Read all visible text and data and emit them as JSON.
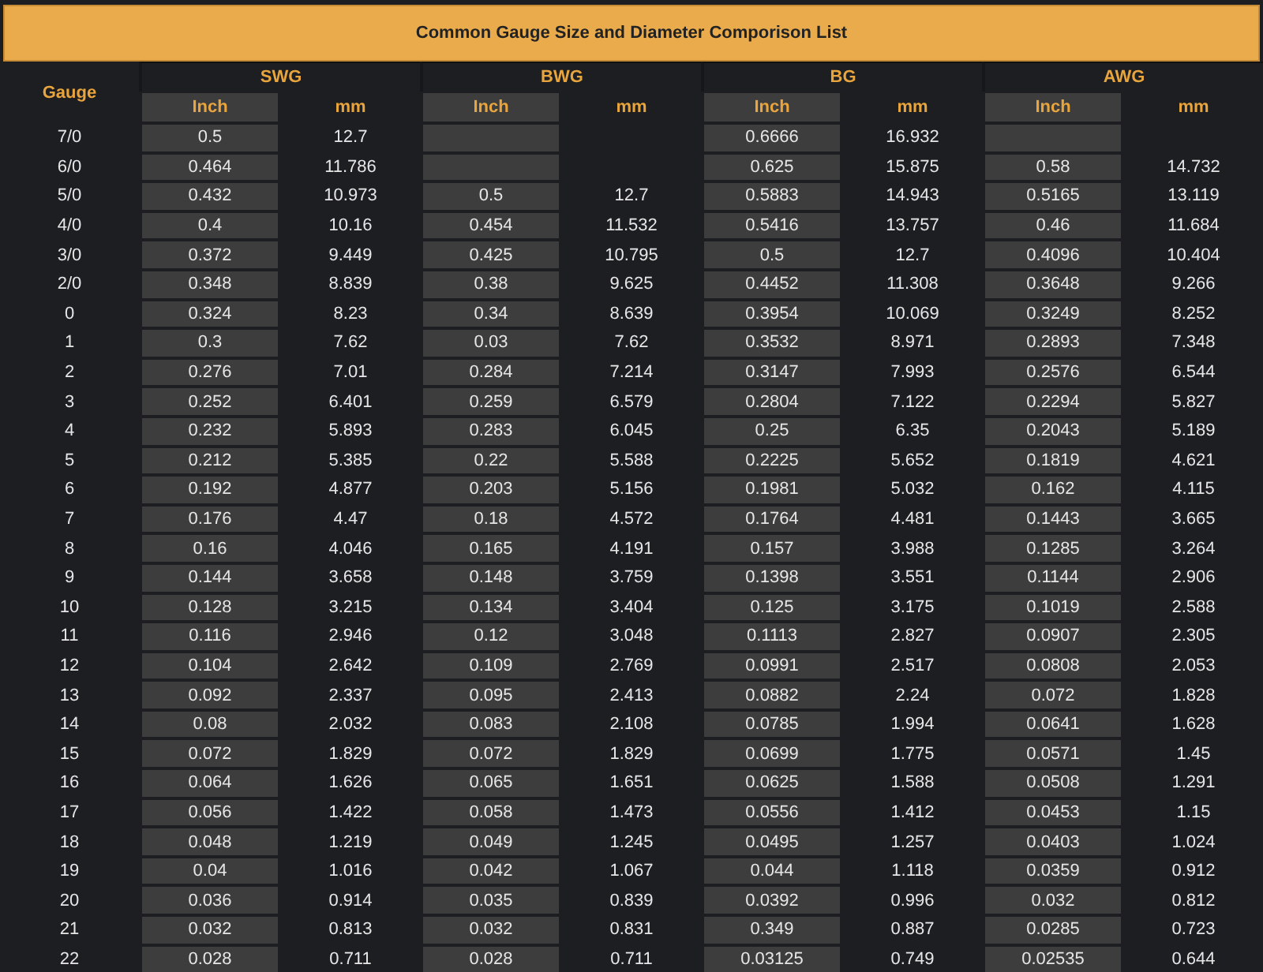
{
  "title": "Common Gauge Size and Diameter Comporison List",
  "columns": {
    "gauge": "Gauge",
    "standards": [
      {
        "name": "SWG",
        "inch": "Inch",
        "mm": "mm"
      },
      {
        "name": "BWG",
        "inch": "Inch",
        "mm": "mm"
      },
      {
        "name": "BG",
        "inch": "Inch",
        "mm": "mm"
      },
      {
        "name": "AWG",
        "inch": "Inch",
        "mm": "mm"
      }
    ]
  },
  "rows": [
    {
      "gauge": "7/0",
      "swg": {
        "inch": "0.5",
        "mm": "12.7"
      },
      "bg": {
        "inch": "0.6666",
        "mm": "16.932"
      }
    },
    {
      "gauge": "6/0",
      "swg": {
        "inch": "0.464",
        "mm": "11.786"
      },
      "bg": {
        "inch": "0.625",
        "mm": "15.875"
      },
      "awg": {
        "inch": "0.58",
        "mm": "14.732"
      }
    },
    {
      "gauge": "5/0",
      "swg": {
        "inch": "0.432",
        "mm": "10.973"
      },
      "bwg": {
        "inch": "0.5",
        "mm": "12.7"
      },
      "bg": {
        "inch": "0.5883",
        "mm": "14.943"
      },
      "awg": {
        "inch": "0.5165",
        "mm": "13.119"
      }
    },
    {
      "gauge": "4/0",
      "swg": {
        "inch": "0.4",
        "mm": "10.16"
      },
      "bwg": {
        "inch": "0.454",
        "mm": "11.532"
      },
      "bg": {
        "inch": "0.5416",
        "mm": "13.757"
      },
      "awg": {
        "inch": "0.46",
        "mm": "11.684"
      }
    },
    {
      "gauge": "3/0",
      "swg": {
        "inch": "0.372",
        "mm": "9.449"
      },
      "bwg": {
        "inch": "0.425",
        "mm": "10.795"
      },
      "bg": {
        "inch": "0.5",
        "mm": "12.7"
      },
      "awg": {
        "inch": "0.4096",
        "mm": "10.404"
      }
    },
    {
      "gauge": "2/0",
      "swg": {
        "inch": "0.348",
        "mm": "8.839"
      },
      "bwg": {
        "inch": "0.38",
        "mm": "9.625"
      },
      "bg": {
        "inch": "0.4452",
        "mm": "11.308"
      },
      "awg": {
        "inch": "0.3648",
        "mm": "9.266"
      }
    },
    {
      "gauge": "0",
      "swg": {
        "inch": "0.324",
        "mm": "8.23"
      },
      "bwg": {
        "inch": "0.34",
        "mm": "8.639"
      },
      "bg": {
        "inch": "0.3954",
        "mm": "10.069"
      },
      "awg": {
        "inch": "0.3249",
        "mm": "8.252"
      }
    },
    {
      "gauge": "1",
      "swg": {
        "inch": "0.3",
        "mm": "7.62"
      },
      "bwg": {
        "inch": "0.03",
        "mm": "7.62"
      },
      "bg": {
        "inch": "0.3532",
        "mm": "8.971"
      },
      "awg": {
        "inch": "0.2893",
        "mm": "7.348"
      }
    },
    {
      "gauge": "2",
      "swg": {
        "inch": "0.276",
        "mm": "7.01"
      },
      "bwg": {
        "inch": "0.284",
        "mm": "7.214"
      },
      "bg": {
        "inch": "0.3147",
        "mm": "7.993"
      },
      "awg": {
        "inch": "0.2576",
        "mm": "6.544"
      }
    },
    {
      "gauge": "3",
      "swg": {
        "inch": "0.252",
        "mm": "6.401"
      },
      "bwg": {
        "inch": "0.259",
        "mm": "6.579"
      },
      "bg": {
        "inch": "0.2804",
        "mm": "7.122"
      },
      "awg": {
        "inch": "0.2294",
        "mm": "5.827"
      }
    },
    {
      "gauge": "4",
      "swg": {
        "inch": "0.232",
        "mm": "5.893"
      },
      "bwg": {
        "inch": "0.283",
        "mm": "6.045"
      },
      "bg": {
        "inch": "0.25",
        "mm": "6.35"
      },
      "awg": {
        "inch": "0.2043",
        "mm": "5.189"
      }
    },
    {
      "gauge": "5",
      "swg": {
        "inch": "0.212",
        "mm": "5.385"
      },
      "bwg": {
        "inch": "0.22",
        "mm": "5.588"
      },
      "bg": {
        "inch": "0.2225",
        "mm": "5.652"
      },
      "awg": {
        "inch": "0.1819",
        "mm": "4.621"
      }
    },
    {
      "gauge": "6",
      "swg": {
        "inch": "0.192",
        "mm": "4.877"
      },
      "bwg": {
        "inch": "0.203",
        "mm": "5.156"
      },
      "bg": {
        "inch": "0.1981",
        "mm": "5.032"
      },
      "awg": {
        "inch": "0.162",
        "mm": "4.115"
      }
    },
    {
      "gauge": "7",
      "swg": {
        "inch": "0.176",
        "mm": "4.47"
      },
      "bwg": {
        "inch": "0.18",
        "mm": "4.572"
      },
      "bg": {
        "inch": "0.1764",
        "mm": "4.481"
      },
      "awg": {
        "inch": "0.1443",
        "mm": "3.665"
      }
    },
    {
      "gauge": "8",
      "swg": {
        "inch": "0.16",
        "mm": "4.046"
      },
      "bwg": {
        "inch": "0.165",
        "mm": "4.191"
      },
      "bg": {
        "inch": "0.157",
        "mm": "3.988"
      },
      "awg": {
        "inch": "0.1285",
        "mm": "3.264"
      }
    },
    {
      "gauge": "9",
      "swg": {
        "inch": "0.144",
        "mm": "3.658"
      },
      "bwg": {
        "inch": "0.148",
        "mm": "3.759"
      },
      "bg": {
        "inch": "0.1398",
        "mm": "3.551"
      },
      "awg": {
        "inch": "0.1144",
        "mm": "2.906"
      }
    },
    {
      "gauge": "10",
      "swg": {
        "inch": "0.128",
        "mm": "3.215"
      },
      "bwg": {
        "inch": "0.134",
        "mm": "3.404"
      },
      "bg": {
        "inch": "0.125",
        "mm": "3.175"
      },
      "awg": {
        "inch": "0.1019",
        "mm": "2.588"
      }
    },
    {
      "gauge": "11",
      "swg": {
        "inch": "0.116",
        "mm": "2.946"
      },
      "bwg": {
        "inch": "0.12",
        "mm": "3.048"
      },
      "bg": {
        "inch": "0.1113",
        "mm": "2.827"
      },
      "awg": {
        "inch": "0.0907",
        "mm": "2.305"
      }
    },
    {
      "gauge": "12",
      "swg": {
        "inch": "0.104",
        "mm": "2.642"
      },
      "bwg": {
        "inch": "0.109",
        "mm": "2.769"
      },
      "bg": {
        "inch": "0.0991",
        "mm": "2.517"
      },
      "awg": {
        "inch": "0.0808",
        "mm": "2.053"
      }
    },
    {
      "gauge": "13",
      "swg": {
        "inch": "0.092",
        "mm": "2.337"
      },
      "bwg": {
        "inch": "0.095",
        "mm": "2.413"
      },
      "bg": {
        "inch": "0.0882",
        "mm": "2.24"
      },
      "awg": {
        "inch": "0.072",
        "mm": "1.828"
      }
    },
    {
      "gauge": "14",
      "swg": {
        "inch": "0.08",
        "mm": "2.032"
      },
      "bwg": {
        "inch": "0.083",
        "mm": "2.108"
      },
      "bg": {
        "inch": "0.0785",
        "mm": "1.994"
      },
      "awg": {
        "inch": "0.0641",
        "mm": "1.628"
      }
    },
    {
      "gauge": "15",
      "swg": {
        "inch": "0.072",
        "mm": "1.829"
      },
      "bwg": {
        "inch": "0.072",
        "mm": "1.829"
      },
      "bg": {
        "inch": "0.0699",
        "mm": "1.775"
      },
      "awg": {
        "inch": "0.0571",
        "mm": "1.45"
      }
    },
    {
      "gauge": "16",
      "swg": {
        "inch": "0.064",
        "mm": "1.626"
      },
      "bwg": {
        "inch": "0.065",
        "mm": "1.651"
      },
      "bg": {
        "inch": "0.0625",
        "mm": "1.588"
      },
      "awg": {
        "inch": "0.0508",
        "mm": "1.291"
      }
    },
    {
      "gauge": "17",
      "swg": {
        "inch": "0.056",
        "mm": "1.422"
      },
      "bwg": {
        "inch": "0.058",
        "mm": "1.473"
      },
      "bg": {
        "inch": "0.0556",
        "mm": "1.412"
      },
      "awg": {
        "inch": "0.0453",
        "mm": "1.15"
      }
    },
    {
      "gauge": "18",
      "swg": {
        "inch": "0.048",
        "mm": "1.219"
      },
      "bwg": {
        "inch": "0.049",
        "mm": "1.245"
      },
      "bg": {
        "inch": "0.0495",
        "mm": "1.257"
      },
      "awg": {
        "inch": "0.0403",
        "mm": "1.024"
      }
    },
    {
      "gauge": "19",
      "swg": {
        "inch": "0.04",
        "mm": "1.016"
      },
      "bwg": {
        "inch": "0.042",
        "mm": "1.067"
      },
      "bg": {
        "inch": "0.044",
        "mm": "1.118"
      },
      "awg": {
        "inch": "0.0359",
        "mm": "0.912"
      }
    },
    {
      "gauge": "20",
      "swg": {
        "inch": "0.036",
        "mm": "0.914"
      },
      "bwg": {
        "inch": "0.035",
        "mm": "0.839"
      },
      "bg": {
        "inch": "0.0392",
        "mm": "0.996"
      },
      "awg": {
        "inch": "0.032",
        "mm": "0.812"
      }
    },
    {
      "gauge": "21",
      "swg": {
        "inch": "0.032",
        "mm": "0.813"
      },
      "bwg": {
        "inch": "0.032",
        "mm": "0.831"
      },
      "bg": {
        "inch": "0.349",
        "mm": "0.887"
      },
      "awg": {
        "inch": "0.0285",
        "mm": "0.723"
      }
    },
    {
      "gauge": "22",
      "swg": {
        "inch": "0.028",
        "mm": "0.711"
      },
      "bwg": {
        "inch": "0.028",
        "mm": "0.711"
      },
      "bg": {
        "inch": "0.03125",
        "mm": "0.749"
      },
      "awg": {
        "inch": "0.02535",
        "mm": "0.644"
      }
    }
  ]
}
